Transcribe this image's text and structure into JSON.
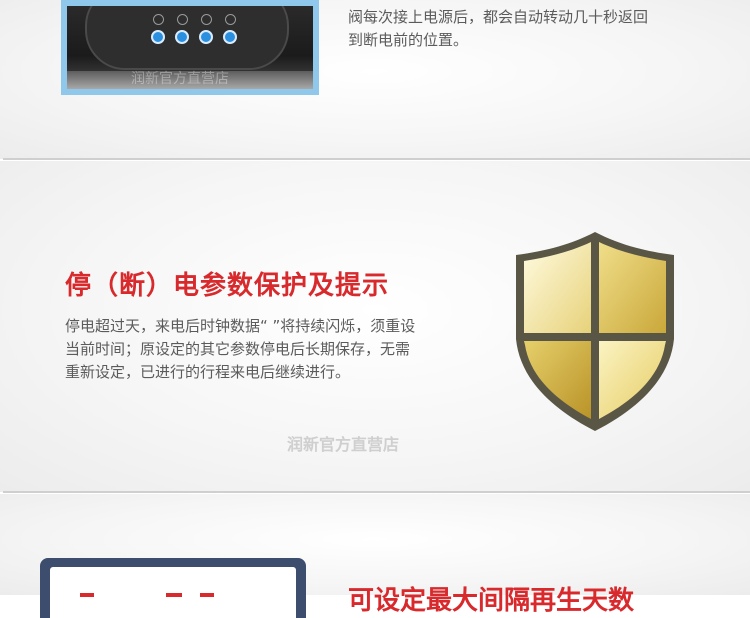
{
  "section1": {
    "description_lines": [
      "阀每次接上电源后，都会自动转动几十秒返回",
      "到断电前的位置。"
    ],
    "photo_watermark": "润新官方直营店"
  },
  "section2": {
    "title": "停（断）电参数保护及提示",
    "description_lines": [
      "停电超过天，来电后时钟数据“ ”将持续闪烁，须重设",
      "当前时间；原设定的其它参数停电后长期保存，无需",
      "重新设定，已进行的行程来电后继续进行。"
    ],
    "watermark": "润新官方直营店",
    "icon": "shield-icon",
    "shield_colors": {
      "border": "#5a5646",
      "gold_light": "#fbf3c2",
      "gold_dark": "#c9a73a"
    }
  },
  "section3": {
    "title": "可设定最大间隔再生天数",
    "icon": "monitor-icon"
  },
  "colors": {
    "accent_red": "#d8292c",
    "body_text": "#5b5b5b",
    "device_frame": "#8fc8ea",
    "button_blue": "#2b8fe0"
  }
}
